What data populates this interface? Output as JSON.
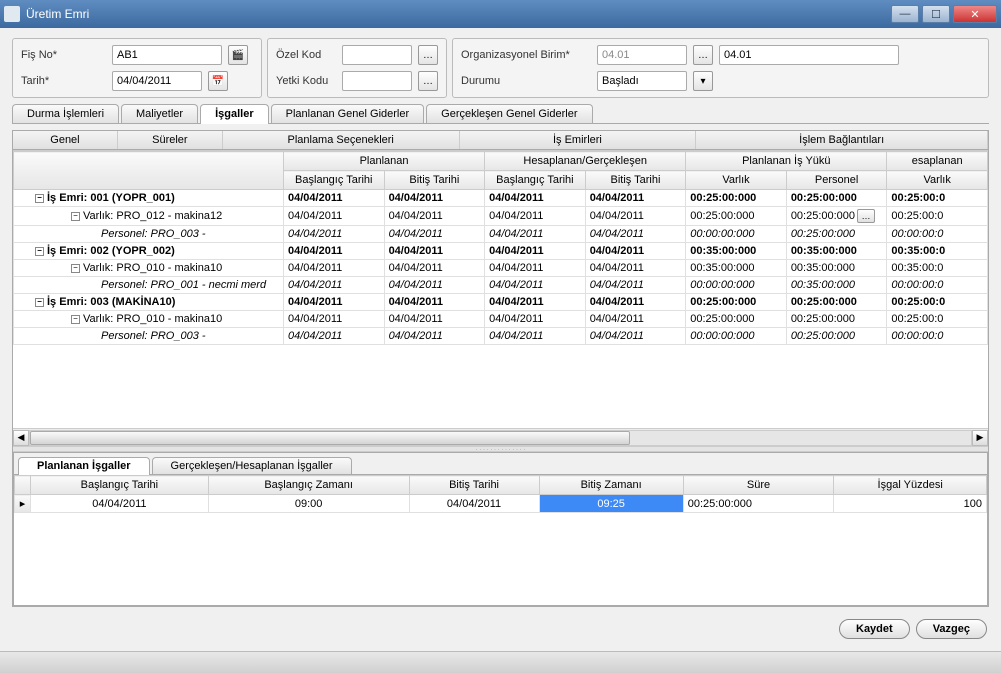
{
  "window": {
    "title": "Üretim Emri"
  },
  "form": {
    "fisNo": {
      "label": "Fiş No*",
      "value": "AB1"
    },
    "tarih": {
      "label": "Tarih*",
      "value": "04/04/2011"
    },
    "ozelKod": {
      "label": "Özel Kod",
      "value": ""
    },
    "yetkiKodu": {
      "label": "Yetki Kodu",
      "value": ""
    },
    "orgBirim": {
      "label": "Organizasyonel Birim*",
      "value1": "04.01",
      "value2": "04.01"
    },
    "durumu": {
      "label": "Durumu",
      "value": "Başladı"
    }
  },
  "tabs1": [
    "Durma İşlemleri",
    "Maliyetler",
    "İşgaller",
    "Planlanan Genel Giderler",
    "Gerçekleşen Genel Giderler"
  ],
  "tabs1_active": 2,
  "tabs2": [
    "Genel",
    "Süreler",
    "Planlama Seçenekleri",
    "İş Emirleri",
    "İşlem Bağlantıları"
  ],
  "gridHeaders": {
    "group1": "Planlanan",
    "group2": "Hesaplanan/Gerçekleşen",
    "group3": "Planlanan İş Yükü",
    "group4": "esaplanan",
    "cols": [
      "Başlangıç Tarihi",
      "Bitiş Tarihi",
      "Başlangıç Tarihi",
      "Bitiş Tarihi",
      "Varlık",
      "Personel",
      "Varlık"
    ]
  },
  "rows": [
    {
      "type": "job",
      "label": "İş Emri: 001 (YOPR_001)",
      "c": [
        "04/04/2011",
        "04/04/2011",
        "04/04/2011",
        "04/04/2011",
        "00:25:00:000",
        "00:25:00:000",
        "00:25:00:0"
      ]
    },
    {
      "type": "asset",
      "label": "Varlık: PRO_012 - makina12",
      "c": [
        "04/04/2011",
        "04/04/2011",
        "04/04/2011",
        "04/04/2011",
        "00:25:00:000",
        "00:25:00:000",
        "00:25:00:0"
      ],
      "personelBtn": true
    },
    {
      "type": "pers",
      "label": "Personel: PRO_003 -",
      "c": [
        "04/04/2011",
        "04/04/2011",
        "04/04/2011",
        "04/04/2011",
        "00:00:00:000",
        "00:25:00:000",
        "00:00:00:0"
      ]
    },
    {
      "type": "job",
      "label": "İş Emri: 002 (YOPR_002)",
      "c": [
        "04/04/2011",
        "04/04/2011",
        "04/04/2011",
        "04/04/2011",
        "00:35:00:000",
        "00:35:00:000",
        "00:35:00:0"
      ]
    },
    {
      "type": "asset",
      "label": "Varlık: PRO_010 - makina10",
      "c": [
        "04/04/2011",
        "04/04/2011",
        "04/04/2011",
        "04/04/2011",
        "00:35:00:000",
        "00:35:00:000",
        "00:35:00:0"
      ]
    },
    {
      "type": "pers",
      "label": "Personel: PRO_001 - necmi merd",
      "c": [
        "04/04/2011",
        "04/04/2011",
        "04/04/2011",
        "04/04/2011",
        "00:00:00:000",
        "00:35:00:000",
        "00:00:00:0"
      ]
    },
    {
      "type": "job",
      "label": "İş Emri: 003 (MAKİNA10)",
      "c": [
        "04/04/2011",
        "04/04/2011",
        "04/04/2011",
        "04/04/2011",
        "00:25:00:000",
        "00:25:00:000",
        "00:25:00:0"
      ]
    },
    {
      "type": "asset",
      "label": "Varlık: PRO_010 - makina10",
      "c": [
        "04/04/2011",
        "04/04/2011",
        "04/04/2011",
        "04/04/2011",
        "00:25:00:000",
        "00:25:00:000",
        "00:25:00:0"
      ]
    },
    {
      "type": "pers",
      "label": "Personel: PRO_003 -",
      "c": [
        "04/04/2011",
        "04/04/2011",
        "04/04/2011",
        "04/04/2011",
        "00:00:00:000",
        "00:25:00:000",
        "00:00:00:0"
      ]
    }
  ],
  "lowerTabs": [
    "Planlanan İşgaller",
    "Gerçekleşen/Hesaplanan İşgaller"
  ],
  "lowerCols": [
    "Başlangıç Tarihi",
    "Başlangıç Zamanı",
    "Bitiş Tarihi",
    "Bitiş Zamanı",
    "Süre",
    "İşgal Yüzdesi"
  ],
  "lowerRow": {
    "basT": "04/04/2011",
    "basZ": "09:00",
    "bitT": "04/04/2011",
    "bitZ": "09:25",
    "sure": "00:25:00:000",
    "yuzde": "100"
  },
  "buttons": {
    "save": "Kaydet",
    "cancel": "Vazgeç"
  }
}
